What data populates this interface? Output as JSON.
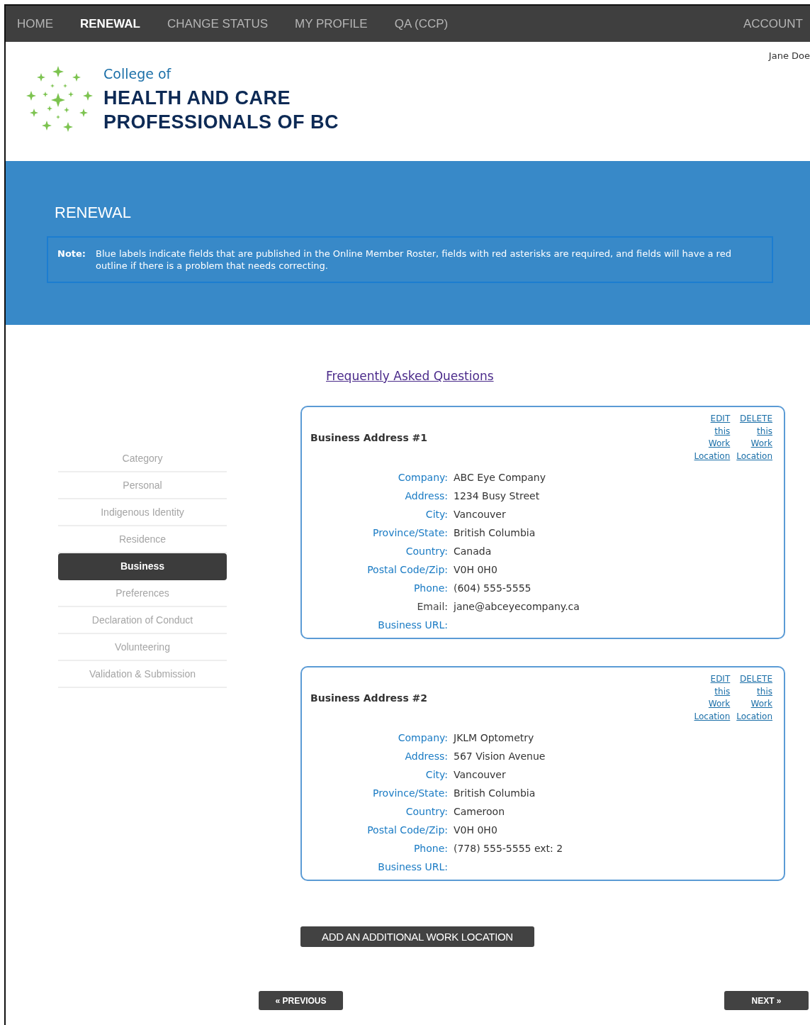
{
  "nav": {
    "items": [
      {
        "label": "HOME",
        "selected": false
      },
      {
        "label": "RENEWAL",
        "selected": true
      },
      {
        "label": "CHANGE STATUS",
        "selected": false
      },
      {
        "label": "MY PROFILE",
        "selected": false
      },
      {
        "label": "QA (CCP)",
        "selected": false
      }
    ],
    "account": "ACCOUNT"
  },
  "user_name": "Jane Doe",
  "logo": {
    "line_1": "College of",
    "line_2": "HEALTH AND CARE",
    "line_3": "PROFESSIONALS OF BC"
  },
  "page_title": "RENEWAL",
  "note": {
    "label": "Note:",
    "text": "Blue labels indicate fields that are published in the Online Member Roster, fields with red asterisks are required, and fields will have a red outline if there is a problem that needs correcting."
  },
  "faq_link": "Frequently Asked Questions",
  "sidebar": {
    "items": [
      {
        "label": "Category",
        "selected": false
      },
      {
        "label": "Personal",
        "selected": false
      },
      {
        "label": "Indigenous Identity",
        "selected": false
      },
      {
        "label": "Residence",
        "selected": false
      },
      {
        "label": "Business",
        "selected": true
      },
      {
        "label": "Preferences",
        "selected": false
      },
      {
        "label": "Declaration of Conduct",
        "selected": false
      },
      {
        "label": "Volunteering",
        "selected": false
      },
      {
        "label": "Validation & Submission",
        "selected": false
      }
    ]
  },
  "addresses": [
    {
      "title": "Business Address #1",
      "edit_link": "EDIT this Work Location",
      "delete_link": "DELETE this Work Location",
      "fields": [
        {
          "label": "Company:",
          "value": "ABC Eye Company",
          "published": true
        },
        {
          "label": "Address:",
          "value": "1234 Busy Street",
          "published": true
        },
        {
          "label": "City:",
          "value": "Vancouver",
          "published": true
        },
        {
          "label": "Province/State:",
          "value": "British Columbia",
          "published": true
        },
        {
          "label": "Country:",
          "value": "Canada",
          "published": true
        },
        {
          "label": "Postal Code/Zip:",
          "value": "V0H 0H0",
          "published": true
        },
        {
          "label": "Phone:",
          "value": "(604) 555-5555",
          "published": true
        },
        {
          "label": "Email:",
          "value": "jane@abceyecompany.ca",
          "published": false
        },
        {
          "label": "Business URL:",
          "published": true
        }
      ]
    },
    {
      "title": "Business Address #2",
      "edit_link": "EDIT this Work Location",
      "delete_link": "DELETE this Work Location",
      "fields": [
        {
          "label": "Company:",
          "value": "JKLM Optometry",
          "published": true
        },
        {
          "label": "Address:",
          "value": "567 Vision Avenue",
          "published": true
        },
        {
          "label": "City:",
          "value": "Vancouver",
          "published": true
        },
        {
          "label": "Province/State:",
          "value": "British Columbia",
          "published": true
        },
        {
          "label": "Country:",
          "value": "Cameroon",
          "published": true
        },
        {
          "label": "Postal Code/Zip:",
          "value": "V0H 0H0",
          "published": true
        },
        {
          "label": "Phone:",
          "value": "(778) 555-5555 ext: 2",
          "published": true
        },
        {
          "label": "Business URL:",
          "published": true
        }
      ]
    }
  ],
  "add_button": "ADD AN ADDITIONAL WORK LOCATION",
  "previous_button": "« PREVIOUS",
  "next_button": "NEXT »"
}
